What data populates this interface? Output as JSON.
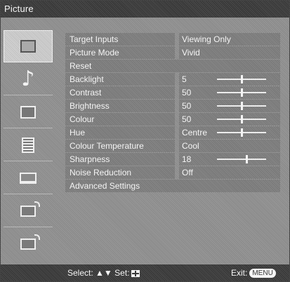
{
  "header": {
    "title": "Picture"
  },
  "sidebar": {
    "items": [
      {
        "icon": "picture-icon",
        "selected": true
      },
      {
        "icon": "music-note-icon",
        "selected": false
      },
      {
        "icon": "screen-icon",
        "selected": false
      },
      {
        "icon": "list-icon",
        "selected": false
      },
      {
        "icon": "laptop-icon",
        "selected": false
      },
      {
        "icon": "tv-signal-icon",
        "selected": false
      },
      {
        "icon": "tv-signal-icon-2",
        "selected": false
      }
    ]
  },
  "menu": {
    "rows": [
      {
        "label": "Target Inputs",
        "value": "Viewing Only"
      },
      {
        "label": "Picture Mode",
        "value": "Vivid"
      },
      {
        "label": "Reset",
        "value": ""
      },
      {
        "label": "Backlight",
        "value": "5",
        "slider_level": 0.5
      },
      {
        "label": "Contrast",
        "value": "50",
        "slider_level": 0.5
      },
      {
        "label": "Brightness",
        "value": "50",
        "slider_level": 0.5
      },
      {
        "label": "Colour",
        "value": "50",
        "slider_level": 0.5
      },
      {
        "label": "Hue",
        "value": "Centre",
        "slider_level": 0.5
      },
      {
        "label": "Colour Temperature",
        "value": "Cool"
      },
      {
        "label": "Sharpness",
        "value": "18",
        "slider_level": 0.6
      },
      {
        "label": "Noise Reduction",
        "value": "Off"
      },
      {
        "label": "Advanced Settings",
        "value": ""
      }
    ]
  },
  "footer": {
    "select_label": "Select:",
    "set_label": "Set:",
    "exit_label": "Exit:",
    "menu_button": "MENU"
  }
}
